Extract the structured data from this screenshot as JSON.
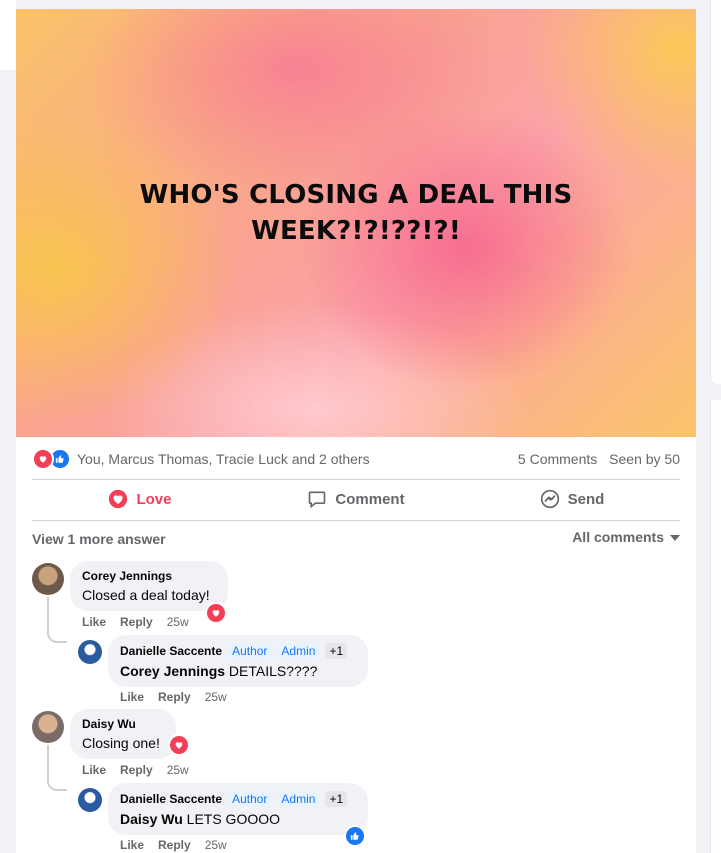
{
  "post": {
    "banner_text": "WHO'S CLOSING A DEAL THIS WEEK?!?!??!?!",
    "reactors": "You, Marcus Thomas, Tracie Luck and 2 others",
    "comments_count": "5 Comments",
    "seen_by": "Seen by 50"
  },
  "actions": {
    "love": "Love",
    "comment": "Comment",
    "send": "Send"
  },
  "comments_header": {
    "view_more": "View 1 more answer",
    "sort": "All comments"
  },
  "comments": [
    {
      "name": "Corey Jennings",
      "text": "Closed a deal today!",
      "like": "Like",
      "reply": "Reply",
      "time": "25w",
      "reply_item": {
        "name": "Danielle Saccente",
        "badge_author": "Author",
        "badge_admin": "Admin",
        "badge_more": "+1",
        "mention": "Corey Jennings",
        "text": " DETAILS????",
        "like": "Like",
        "reply": "Reply",
        "time": "25w"
      }
    },
    {
      "name": "Daisy Wu",
      "text": "Closing one!",
      "like": "Like",
      "reply": "Reply",
      "time": "25w",
      "reply_item": {
        "name": "Danielle Saccente",
        "badge_author": "Author",
        "badge_admin": "Admin",
        "badge_more": "+1",
        "mention": "Daisy Wu",
        "text": " LETS GOOOO",
        "like": "Like",
        "reply": "Reply",
        "time": "25w"
      }
    }
  ],
  "colors": {
    "love": "#f33e58",
    "like": "#1877f2",
    "secondary_text": "#65676b"
  },
  "icons": [
    "love-reaction-icon",
    "like-reaction-icon",
    "comment-icon",
    "messenger-icon",
    "caret-down-icon"
  ]
}
